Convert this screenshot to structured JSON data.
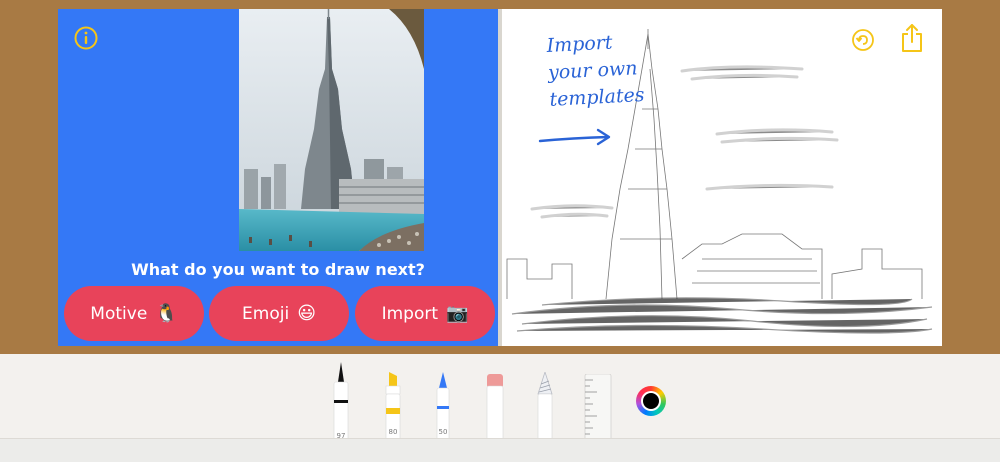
{
  "left_panel": {
    "prompt": "What do you want to draw next?",
    "buttons": [
      {
        "label": "Motive",
        "emoji": "🐧"
      },
      {
        "label": "Emoji",
        "emoji": "😃"
      },
      {
        "label": "Import",
        "emoji": "📷"
      }
    ],
    "icons": {
      "info": "info-icon"
    }
  },
  "right_panel": {
    "note_lines": [
      "Import",
      "your own",
      "templates"
    ],
    "icons": {
      "undo": "undo-icon",
      "share": "share-icon"
    }
  },
  "toolbar": {
    "tools": [
      {
        "name": "pen",
        "width_label": "97"
      },
      {
        "name": "marker",
        "width_label": "80"
      },
      {
        "name": "pencil",
        "width_label": "50"
      },
      {
        "name": "eraser"
      },
      {
        "name": "lasso"
      },
      {
        "name": "ruler"
      }
    ],
    "selected_color": "#000000"
  },
  "colors": {
    "background": "#a87a44",
    "left_panel": "#3478f6",
    "button": "#e8435a",
    "accent_yellow": "#f5c518",
    "note_blue": "#2a63d6"
  }
}
